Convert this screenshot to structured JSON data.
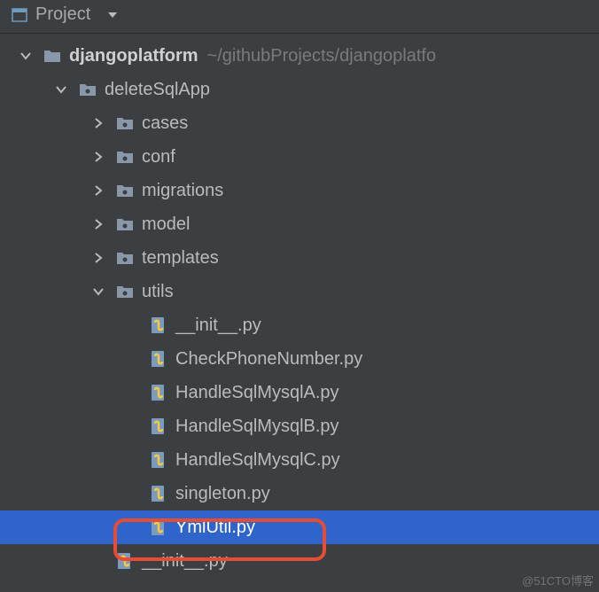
{
  "topbar": {
    "label": "Project"
  },
  "tree": {
    "root": {
      "name": "djangoplatform",
      "path": "~/githubProjects/djangoplatfo"
    },
    "deleteSqlApp": {
      "name": "deleteSqlApp"
    },
    "folders": {
      "cases": "cases",
      "conf": "conf",
      "migrations": "migrations",
      "model": "model",
      "templates": "templates",
      "utils": "utils"
    },
    "files": {
      "init1": "__init__.py",
      "checkPhone": "CheckPhoneNumber.py",
      "handleA": "HandleSqlMysqlA.py",
      "handleB": "HandleSqlMysqlB.py",
      "handleC": "HandleSqlMysqlC.py",
      "singleton": "singleton.py",
      "ymlUtil": "YmlUtil.py",
      "init2": "__init__.py"
    }
  },
  "watermark": "@51CTO博客"
}
